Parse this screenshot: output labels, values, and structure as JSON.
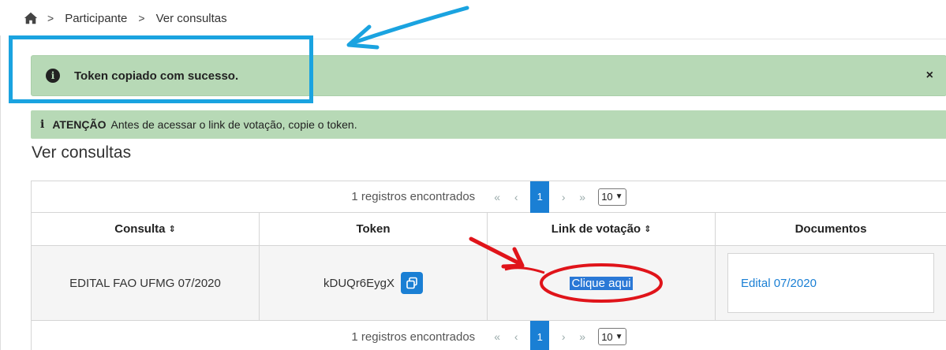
{
  "breadcrumb": {
    "items": [
      "Participante",
      "Ver consultas"
    ],
    "separator": ">"
  },
  "alerts": {
    "success_message": "Token copiado com sucesso.",
    "close_symbol": "×",
    "info_icon": "i",
    "attention_label": "ATENÇÃO",
    "attention_text": "Antes de acessar o link de votação, copie o token."
  },
  "page": {
    "title": "Ver consultas"
  },
  "pagination": {
    "count_text": "1 registros encontrados",
    "first": "«",
    "prev": "‹",
    "current_page": "1",
    "next": "›",
    "last": "»",
    "per_page": "10"
  },
  "table": {
    "headers": [
      "Consulta",
      "Token",
      "Link de votação",
      "Documentos"
    ],
    "sort_symbol": "⇕",
    "rows": [
      {
        "consulta": "EDITAL FAO UFMG 07/2020",
        "token": "kDUQr6EygX",
        "link": "Clique aqui",
        "documento": "Edital 07/2020"
      }
    ]
  },
  "colors": {
    "alert_green": "#b7d9b6",
    "primary_blue": "#1a7fd4",
    "annotation_blue": "#1aa3e0",
    "annotation_red": "#e0141a"
  },
  "icons": [
    "home-icon",
    "chevron-right-icon",
    "info-circle-icon",
    "close-icon",
    "copy-icon",
    "sort-icon",
    "chevron-down-icon"
  ]
}
